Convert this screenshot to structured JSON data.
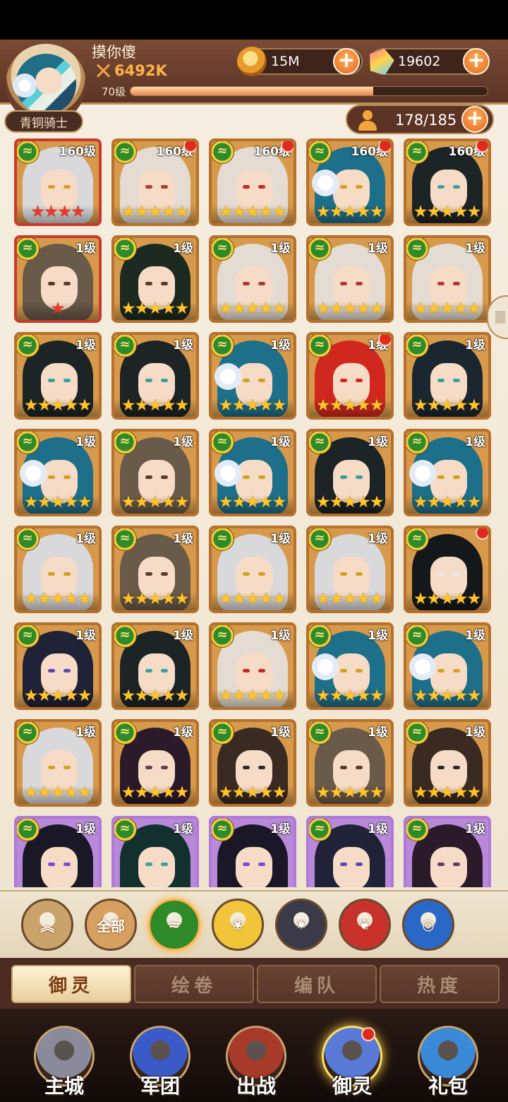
{
  "header": {
    "player_name": "摸你傻",
    "power": "6492K",
    "level_label": "70级",
    "exp_fraction": 0.68,
    "title_badge": "青铜骑士",
    "gold": "15M",
    "gems": "19602",
    "roster": "178/185",
    "icons": {
      "coin": "gold-coin-icon",
      "gem": "gem-icon",
      "power": "crossed-swords-icon",
      "roster": "person-icon",
      "plus": "plus-icon"
    }
  },
  "faction_glyph": "≈",
  "cards": [
    {
      "level": "160级",
      "stars": 4,
      "star_color": "red",
      "frame": "red",
      "dot": false,
      "hair": "#d9d9dc",
      "eye": "#d5a020"
    },
    {
      "level": "160级",
      "stars": 5,
      "star_color": "gold",
      "frame": "gold",
      "dot": true,
      "hair": "#e4dcd2",
      "eye": "#b03a3a"
    },
    {
      "level": "160级",
      "stars": 5,
      "star_color": "gold",
      "frame": "gold",
      "dot": true,
      "hair": "#e4dcd2",
      "eye": "#c02a2a"
    },
    {
      "level": "160级",
      "stars": 5,
      "star_color": "gold",
      "frame": "gold",
      "dot": true,
      "hair": "#1e6f8a",
      "eye": "#d5a020",
      "flower": true
    },
    {
      "level": "160级",
      "stars": 5,
      "star_color": "gold",
      "frame": "gold",
      "dot": true,
      "hair": "#1c2426",
      "eye": "#3aa0a0"
    },
    {
      "level": "1级",
      "stars": 1,
      "star_color": "red",
      "frame": "red",
      "dot": false,
      "hair": "#6a5a4a",
      "eye": "#5a3a2a"
    },
    {
      "level": "1级",
      "stars": 5,
      "star_color": "gold",
      "frame": "gold",
      "dot": false,
      "hair": "#1c2a22",
      "eye": "#5a3a2a"
    },
    {
      "level": "1级",
      "stars": 5,
      "star_color": "gold",
      "frame": "gold",
      "dot": false,
      "hair": "#e4dcd2",
      "eye": "#b03a3a"
    },
    {
      "level": "1级",
      "stars": 5,
      "star_color": "gold",
      "frame": "gold",
      "dot": false,
      "hair": "#e4dcd2",
      "eye": "#b03a3a"
    },
    {
      "level": "1级",
      "stars": 5,
      "star_color": "gold",
      "frame": "gold",
      "dot": false,
      "hair": "#e4dcd2",
      "eye": "#b03a3a"
    },
    {
      "level": "1级",
      "stars": 5,
      "star_color": "gold",
      "frame": "gold",
      "dot": false,
      "hair": "#1c2426",
      "eye": "#3aa0a0"
    },
    {
      "level": "1级",
      "stars": 5,
      "star_color": "gold",
      "frame": "gold",
      "dot": false,
      "hair": "#1c2426",
      "eye": "#3aa0a0"
    },
    {
      "level": "1级",
      "stars": 5,
      "star_color": "gold",
      "frame": "gold",
      "dot": false,
      "hair": "#1e6f8a",
      "eye": "#d5a020",
      "flower": true
    },
    {
      "level": "1级",
      "stars": 5,
      "star_color": "gold",
      "frame": "gold",
      "dot": true,
      "hair": "#d0281e",
      "eye": "#d0281e"
    },
    {
      "level": "1级",
      "stars": 5,
      "star_color": "gold",
      "frame": "gold",
      "dot": false,
      "hair": "#1a2630",
      "eye": "#3aa0a0"
    },
    {
      "level": "1级",
      "stars": 5,
      "star_color": "gold",
      "frame": "gold",
      "dot": false,
      "hair": "#1e6f8a",
      "eye": "#d5a020",
      "flower": true
    },
    {
      "level": "1级",
      "stars": 5,
      "star_color": "gold",
      "frame": "gold",
      "dot": false,
      "hair": "#6a5a4a",
      "eye": "#5a3a2a"
    },
    {
      "level": "1级",
      "stars": 5,
      "star_color": "gold",
      "frame": "gold",
      "dot": false,
      "hair": "#1e6f8a",
      "eye": "#d5a020",
      "flower": true
    },
    {
      "level": "1级",
      "stars": 5,
      "star_color": "gold",
      "frame": "gold",
      "dot": false,
      "hair": "#1c2426",
      "eye": "#3aa0a0"
    },
    {
      "level": "1级",
      "stars": 5,
      "star_color": "gold",
      "frame": "gold",
      "dot": false,
      "hair": "#1e6f8a",
      "eye": "#d5a020",
      "flower": true
    },
    {
      "level": "1级",
      "stars": 5,
      "star_color": "gold",
      "frame": "gold",
      "dot": false,
      "hair": "#d9d9dc",
      "eye": "#d5a020"
    },
    {
      "level": "1级",
      "stars": 5,
      "star_color": "gold",
      "frame": "gold",
      "dot": false,
      "hair": "#6a5a4a",
      "eye": "#5a3a2a"
    },
    {
      "level": "1级",
      "stars": 5,
      "star_color": "gold",
      "frame": "gold",
      "dot": false,
      "hair": "#d9d9dc",
      "eye": "#d5a020"
    },
    {
      "level": "1级",
      "stars": 5,
      "star_color": "gold",
      "frame": "gold",
      "dot": false,
      "hair": "#d9d9dc",
      "eye": "#d5a020"
    },
    {
      "level": "",
      "stars": 5,
      "star_color": "gold",
      "frame": "gold",
      "dot": true,
      "hair": "#15181a",
      "eye": "#e8e8e8"
    },
    {
      "level": "1级",
      "stars": 5,
      "star_color": "gold",
      "frame": "gold",
      "dot": false,
      "hair": "#202238",
      "eye": "#5a4ab0"
    },
    {
      "level": "1级",
      "stars": 5,
      "star_color": "gold",
      "frame": "gold",
      "dot": false,
      "hair": "#1c2426",
      "eye": "#3aa0a0"
    },
    {
      "level": "1级",
      "stars": 5,
      "star_color": "gold",
      "frame": "gold",
      "dot": false,
      "hair": "#e4dcd2",
      "eye": "#c02a2a"
    },
    {
      "level": "1级",
      "stars": 5,
      "star_color": "gold",
      "frame": "gold",
      "dot": false,
      "hair": "#1e6f8a",
      "eye": "#d5a020",
      "flower": true
    },
    {
      "level": "1级",
      "stars": 5,
      "star_color": "gold",
      "frame": "gold",
      "dot": false,
      "hair": "#1e6f8a",
      "eye": "#d5a020",
      "flower": true
    },
    {
      "level": "1级",
      "stars": 5,
      "star_color": "gold",
      "frame": "gold",
      "dot": false,
      "hair": "#d9d9dc",
      "eye": "#d5a020"
    },
    {
      "level": "1级",
      "stars": 5,
      "star_color": "gold",
      "frame": "gold",
      "dot": false,
      "hair": "#2a1a2a",
      "eye": "#6a3a5a"
    },
    {
      "level": "1级",
      "stars": 5,
      "star_color": "gold",
      "frame": "gold",
      "dot": false,
      "hair": "#3a2a22",
      "eye": "#2a2a2a"
    },
    {
      "level": "1级",
      "stars": 5,
      "star_color": "gold",
      "frame": "gold",
      "dot": false,
      "hair": "#6a5a4a",
      "eye": "#5a3a2a"
    },
    {
      "level": "1级",
      "stars": 5,
      "star_color": "gold",
      "frame": "gold",
      "dot": false,
      "hair": "#3a2a22",
      "eye": "#2a2a2a"
    },
    {
      "level": "1级",
      "stars": 0,
      "star_color": "gold",
      "frame": "purple",
      "dot": false,
      "hair": "#1a1826",
      "eye": "#7a4ad0"
    },
    {
      "level": "1级",
      "stars": 0,
      "star_color": "gold",
      "frame": "purple",
      "dot": false,
      "hair": "#12302e",
      "eye": "#3aa0a0"
    },
    {
      "level": "1级",
      "stars": 0,
      "star_color": "gold",
      "frame": "purple",
      "dot": false,
      "hair": "#1a1826",
      "eye": "#7a4ad0"
    },
    {
      "level": "1级",
      "stars": 0,
      "star_color": "gold",
      "frame": "purple",
      "dot": false,
      "hair": "#202238",
      "eye": "#5a4ab0"
    },
    {
      "level": "1级",
      "stars": 0,
      "star_color": "gold",
      "frame": "purple",
      "dot": false,
      "hair": "#2a1a2a",
      "eye": "#6a3a5a"
    }
  ],
  "filters": [
    {
      "name": "collapse-filter-button",
      "label": "",
      "icon": "double-chevron-up-icon",
      "bg": "#c9a36b"
    },
    {
      "name": "filter-all-button",
      "label": "全部",
      "icon": "",
      "bg": "#d7a061"
    },
    {
      "name": "filter-green-faction-button",
      "label": "",
      "icon": "green-faction-icon",
      "bg": "#2f8a2a"
    },
    {
      "name": "filter-gold-rose-button",
      "label": "",
      "icon": "gold-rose-icon",
      "bg": "#f2c43a"
    },
    {
      "name": "filter-dark-star-button",
      "label": "",
      "icon": "dark-star-icon",
      "bg": "#3a3a48"
    },
    {
      "name": "filter-red-phoenix-button",
      "label": "",
      "icon": "red-phoenix-icon",
      "bg": "#c8322a"
    },
    {
      "name": "filter-blue-wave-button",
      "label": "",
      "icon": "blue-wave-icon",
      "bg": "#2a68c8"
    }
  ],
  "tabs": [
    {
      "label": "御灵",
      "active": true
    },
    {
      "label": "绘卷",
      "active": false
    },
    {
      "label": "编队",
      "active": false
    },
    {
      "label": "热度",
      "active": false
    }
  ],
  "nav": [
    {
      "label": "主城",
      "icon": "castle-icon",
      "color": "#8a8a9a",
      "active": false,
      "dot": false
    },
    {
      "label": "军团",
      "icon": "fist-shield-icon",
      "color": "#3a5ac8",
      "active": false,
      "dot": false
    },
    {
      "label": "出战",
      "icon": "battle-gate-icon",
      "color": "#a83a2a",
      "active": false,
      "dot": false
    },
    {
      "label": "御灵",
      "icon": "crystal-icon",
      "color": "#5a7ad8",
      "active": true,
      "dot": true
    },
    {
      "label": "礼包",
      "icon": "shop-stall-icon",
      "color": "#3a8ad8",
      "active": false,
      "dot": false
    }
  ]
}
